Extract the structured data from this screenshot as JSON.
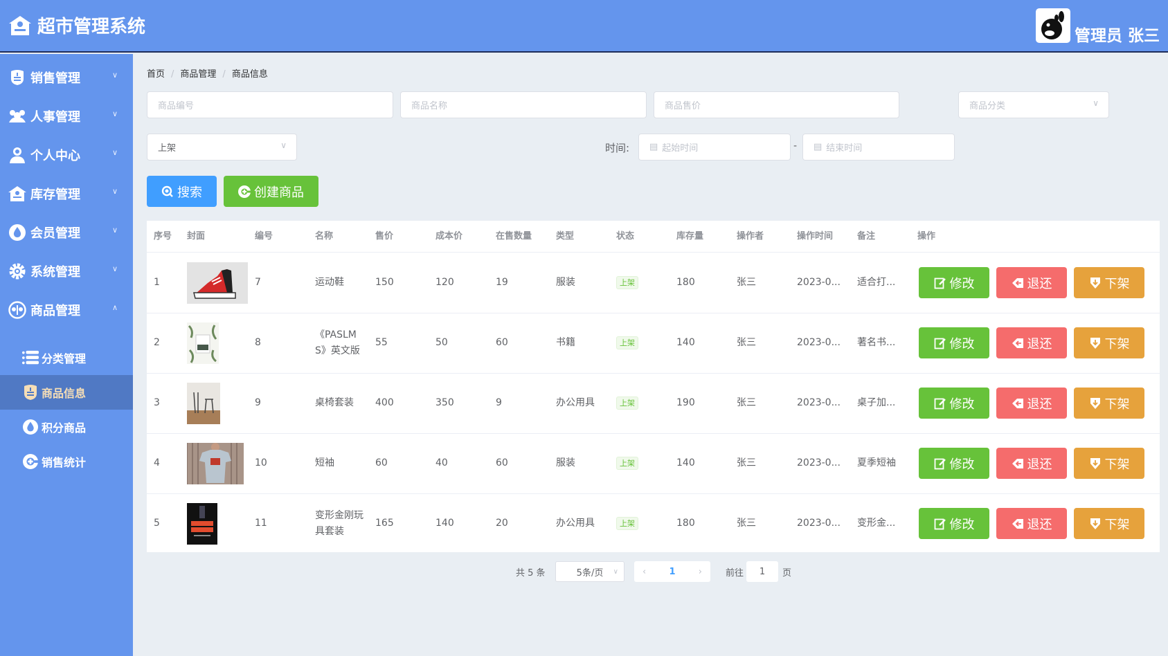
{
  "header": {
    "title": "超市管理系统",
    "user_label": "管理员 张三"
  },
  "sidebar": {
    "menus": [
      {
        "label": "销售管理",
        "icon": "police-badge-icon",
        "expanded": false
      },
      {
        "label": "人事管理",
        "icon": "people-group-icon",
        "expanded": false
      },
      {
        "label": "个人中心",
        "icon": "user-icon",
        "expanded": false
      },
      {
        "label": "库存管理",
        "icon": "warehouse-icon",
        "expanded": false
      },
      {
        "label": "会员管理",
        "icon": "water-drop-icon",
        "expanded": false
      },
      {
        "label": "系统管理",
        "icon": "gear-icon",
        "expanded": false
      },
      {
        "label": "商品管理",
        "icon": "goods-circle-icon",
        "expanded": true
      }
    ],
    "sub_items": [
      {
        "label": "分类管理",
        "icon": "list-icon",
        "active": false
      },
      {
        "label": "商品信息",
        "icon": "badge-icon",
        "active": true
      },
      {
        "label": "积分商品",
        "icon": "water-drop-icon",
        "active": false
      },
      {
        "label": "销售统计",
        "icon": "plus-circle-icon",
        "active": false
      }
    ]
  },
  "breadcrumb": [
    "首页",
    "商品管理",
    "商品信息"
  ],
  "filters": {
    "code_placeholder": "商品编号",
    "name_placeholder": "商品名称",
    "price_placeholder": "商品售价",
    "category_placeholder": "商品分类",
    "status_value": "上架",
    "time_label": "时间:",
    "start_placeholder": "起始时间",
    "end_placeholder": "结束时间",
    "separator": "-"
  },
  "buttons": {
    "search": "搜索",
    "create": "创建商品"
  },
  "table": {
    "columns": [
      "序号",
      "封面",
      "编号",
      "名称",
      "售价",
      "成本价",
      "在售数量",
      "类型",
      "状态",
      "库存量",
      "操作者",
      "操作时间",
      "备注",
      "操作"
    ],
    "actions": {
      "edit": "修改",
      "return": "退还",
      "off": "下架"
    },
    "rows": [
      {
        "index": "1",
        "cover": "red-sneaker",
        "code": "7",
        "name": "运动鞋",
        "price": "150",
        "cost": "120",
        "on_sale": "19",
        "type": "服装",
        "status": "上架",
        "stock": "180",
        "operator": "张三",
        "time": "2023-0...",
        "note": "适合打..."
      },
      {
        "index": "2",
        "cover": "book-leaves",
        "code": "8",
        "name": "《PASLMS》英文版",
        "price": "55",
        "cost": "50",
        "on_sale": "60",
        "type": "书籍",
        "status": "上架",
        "stock": "140",
        "operator": "张三",
        "time": "2023-0...",
        "note": "著名书..."
      },
      {
        "index": "3",
        "cover": "desk-chair",
        "code": "9",
        "name": "桌椅套装",
        "price": "400",
        "cost": "350",
        "on_sale": "9",
        "type": "办公用具",
        "status": "上架",
        "stock": "190",
        "operator": "张三",
        "time": "2023-0...",
        "note": "桌子加..."
      },
      {
        "index": "4",
        "cover": "tshirt",
        "code": "10",
        "name": "短袖",
        "price": "60",
        "cost": "40",
        "on_sale": "60",
        "type": "服装",
        "status": "上架",
        "stock": "140",
        "operator": "张三",
        "time": "2023-0...",
        "note": "夏季短袖"
      },
      {
        "index": "5",
        "cover": "transformer-poster",
        "code": "11",
        "name": "变形金刚玩具套装",
        "price": "165",
        "cost": "140",
        "on_sale": "20",
        "type": "办公用具",
        "status": "上架",
        "stock": "180",
        "operator": "张三",
        "time": "2023-0...",
        "note": "变形金..."
      }
    ]
  },
  "pagination": {
    "total_text": "共 5 条",
    "page_size": "5条/页",
    "current_page": "1",
    "goto_label": "前往",
    "goto_value": "1",
    "page_suffix": "页"
  }
}
